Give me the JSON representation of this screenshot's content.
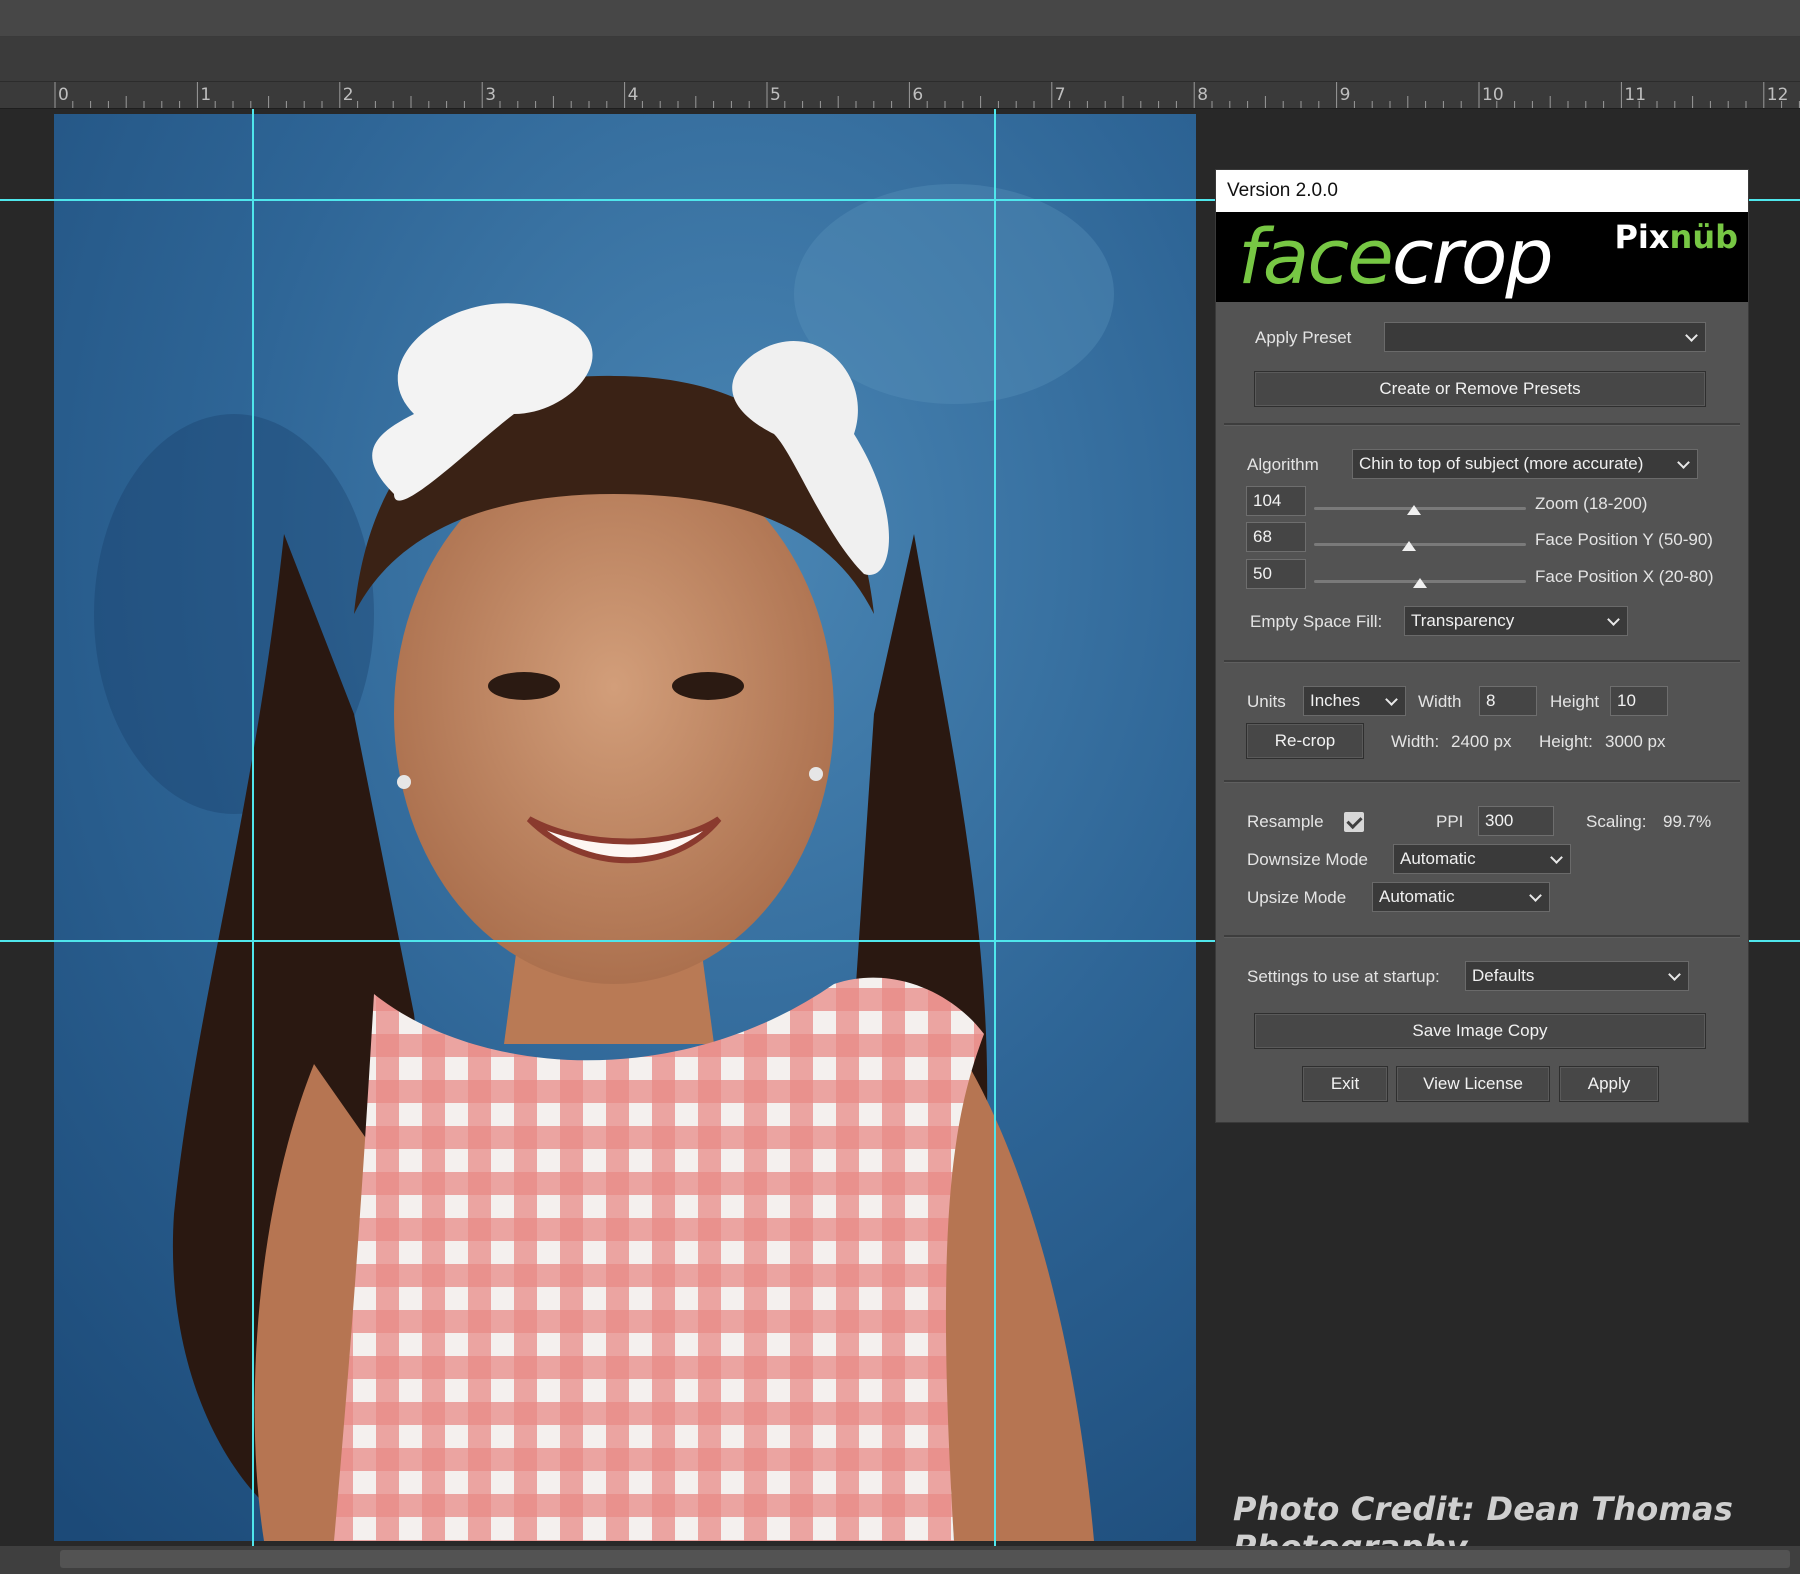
{
  "ruler": {
    "labels": [
      "0",
      "1",
      "2",
      "3",
      "4",
      "5",
      "6",
      "7",
      "8",
      "9",
      "10",
      "11",
      "12"
    ]
  },
  "panel": {
    "version": "Version 2.0.0",
    "brand_face": "face",
    "brand_crop": "crop",
    "logo_pix": "Pix",
    "logo_nub": "nüb",
    "apply_preset_label": "Apply Preset",
    "apply_preset_value": "",
    "create_presets_button": "Create or Remove Presets",
    "algorithm_label": "Algorithm",
    "algorithm_value": "Chin to top of subject (more accurate)",
    "sliders": [
      {
        "value": "104",
        "label": "Zoom (18-200)",
        "min": 18,
        "max": 200
      },
      {
        "value": "68",
        "label": "Face Position Y (50-90)",
        "min": 50,
        "max": 90
      },
      {
        "value": "50",
        "label": "Face Position X (20-80)",
        "min": 20,
        "max": 80
      }
    ],
    "empty_space_label": "Empty Space Fill:",
    "empty_space_value": "Transparency",
    "units_label": "Units",
    "units_value": "Inches",
    "width_label": "Width",
    "width_value": "8",
    "height_label": "Height",
    "height_value": "10",
    "recrop_button": "Re-crop",
    "px_width_label": "Width:",
    "px_width_value": "2400 px",
    "px_height_label": "Height:",
    "px_height_value": "3000 px",
    "resample_label": "Resample",
    "resample_checked": true,
    "ppi_label": "PPI",
    "ppi_value": "300",
    "scaling_label": "Scaling:",
    "scaling_value": "99.7%",
    "downsize_label": "Downsize Mode",
    "downsize_value": "Automatic",
    "upsize_label": "Upsize Mode",
    "upsize_value": "Automatic",
    "startup_label": "Settings to use at startup:",
    "startup_value": "Defaults",
    "save_copy_button": "Save Image Copy",
    "exit_button": "Exit",
    "view_license_button": "View License",
    "apply_button": "Apply"
  },
  "photo_credit": "Photo Credit: Dean Thomas Photography",
  "colors": {
    "brand_green": "#77c744",
    "guide": "#4fe6ec",
    "panel_bg": "#535353"
  }
}
